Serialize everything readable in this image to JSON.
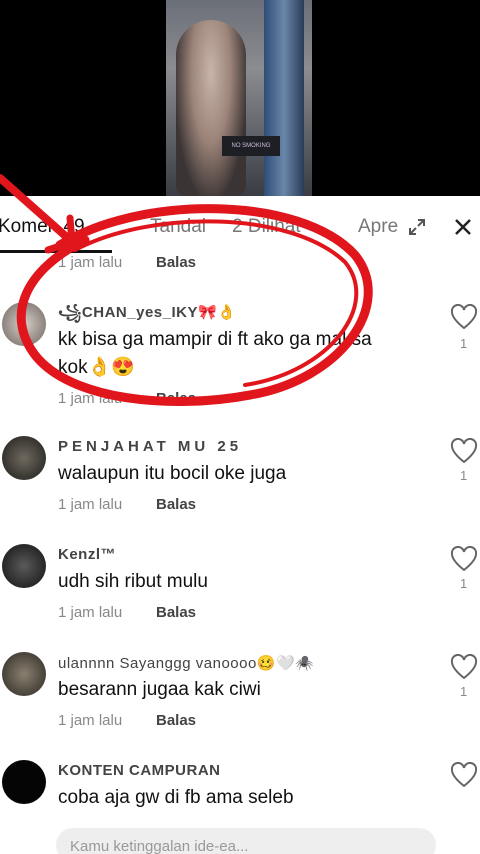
{
  "tabs": {
    "comments": "Komen 49",
    "tab2": "Tandai",
    "tab3": "2 Dilihat",
    "tab4": "Apre"
  },
  "top_comment": {
    "time": "1 jam lalu",
    "reply": "Balas"
  },
  "comments": [
    {
      "username": "꧁CHAN_yes_IKY🎀👌",
      "text": "kk bisa ga mampir di ft ako ga maksa kok👌😍",
      "time": "1 jam lalu",
      "reply": "Balas",
      "likes": "1"
    },
    {
      "username": "PENJAHAT MU 25",
      "text": "walaupun itu bocil oke juga",
      "time": "1 jam lalu",
      "reply": "Balas",
      "likes": "1"
    },
    {
      "username": "Kenzl™",
      "text": "udh sih ribut mulu",
      "time": "1 jam lalu",
      "reply": "Balas",
      "likes": "1"
    },
    {
      "username": "ulannnn Sayanggg vanoooo🥴🤍🕷️",
      "text": "besarann jugaa kak ciwi",
      "time": "1 jam lalu",
      "reply": "Balas",
      "likes": "1"
    },
    {
      "username": "KONTEN CAMPURAN",
      "text": "coba aja gw di fb ama seleb",
      "time": "",
      "reply": "",
      "likes": ""
    }
  ],
  "input": {
    "placeholder": "Kamu ketinggalan ide-ea..."
  },
  "video": {
    "sign_text": "NO SMOKING"
  },
  "colors": {
    "annotation": "#e0161c",
    "sheet_bg": "#ffffff"
  }
}
